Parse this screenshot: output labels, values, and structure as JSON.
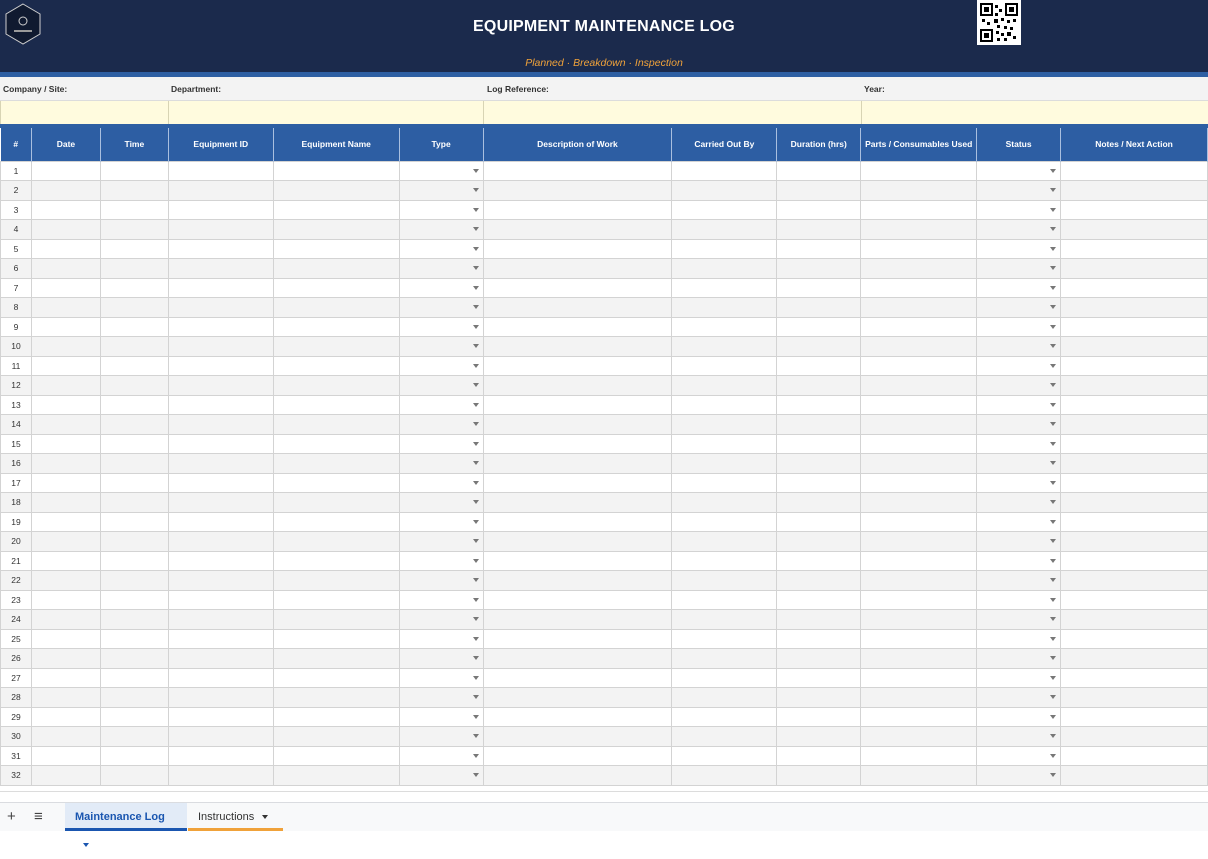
{
  "header": {
    "title": "EQUIPMENT MAINTENANCE LOG",
    "subtitle": "Planned · Breakdown · Inspection",
    "colors": {
      "banner": "#1b2a4c",
      "accent": "#f0a23a",
      "header_blue": "#2d5ea3",
      "input_yellow": "#fffbde"
    }
  },
  "meta": {
    "company_label": "Company / Site:",
    "department_label": "Department:",
    "log_reference_label": "Log Reference:",
    "year_label": "Year:"
  },
  "table": {
    "headers": [
      "#",
      "Date",
      "Time",
      "Equipment ID",
      "Equipment Name",
      "Type",
      "Description of Work",
      "Carried Out By",
      "Duration (hrs)",
      "Parts / Consumables Used",
      "Status",
      "Notes / Next Action"
    ],
    "dropdown_columns": [
      "Type",
      "Status"
    ],
    "row_numbers": [
      "1",
      "2",
      "3",
      "4",
      "5",
      "6",
      "7",
      "8",
      "9",
      "10",
      "11",
      "12",
      "13",
      "14",
      "15",
      "16",
      "17",
      "18",
      "19",
      "20",
      "21",
      "22",
      "23",
      "24",
      "25",
      "26",
      "27",
      "28",
      "29",
      "30",
      "31",
      "32"
    ]
  },
  "tabs": {
    "add_icon": "plus-icon",
    "menu_icon": "hamburger-icon",
    "items": [
      {
        "label": "Maintenance Log",
        "active": true
      },
      {
        "label": "Instructions",
        "active": false
      }
    ]
  }
}
